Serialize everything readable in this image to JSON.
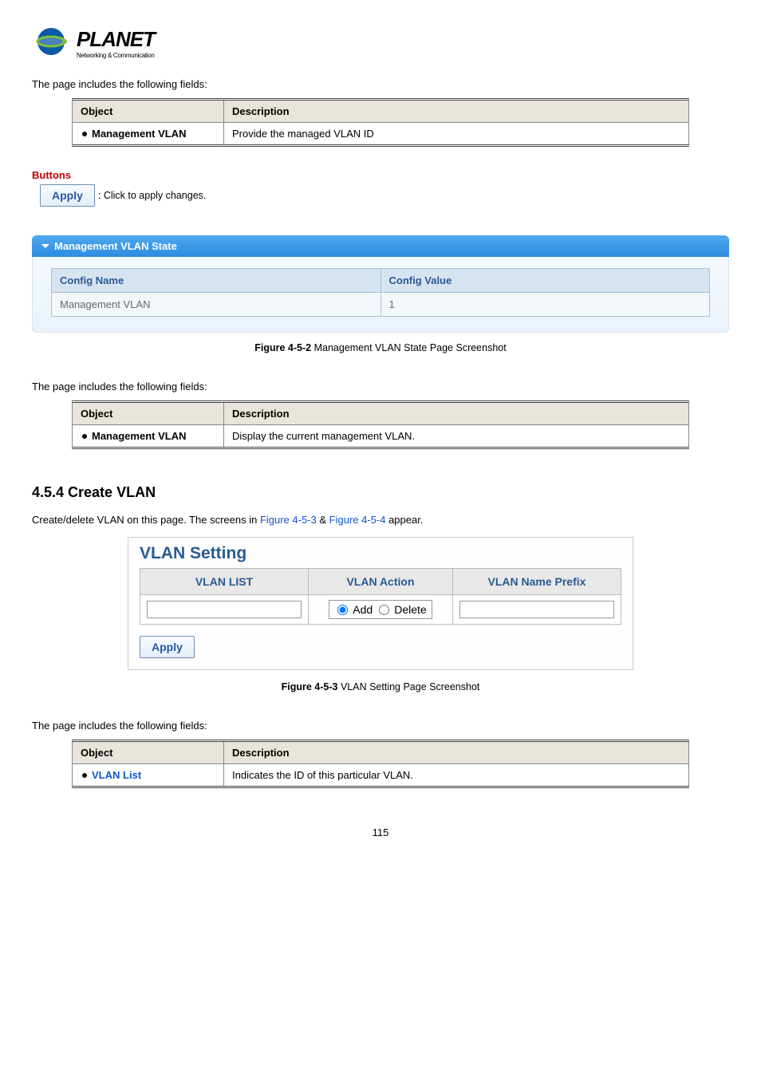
{
  "logo": {
    "brand": "PLANET",
    "tagline": "Networking & Communication"
  },
  "intro1": "The page includes the following fields:",
  "table1": {
    "headers": {
      "object": "Object",
      "description": "Description"
    },
    "row": {
      "object": "Management VLAN",
      "description": "Provide the managed VLAN ID"
    }
  },
  "buttons": {
    "title": "Buttons",
    "apply": "Apply",
    "apply_desc": ": Click to apply changes."
  },
  "panel": {
    "title": "Management VLAN State",
    "headers": {
      "name": "Config Name",
      "value": "Config Value"
    },
    "row": {
      "name": "Management VLAN",
      "value": "1"
    }
  },
  "caption1": {
    "fig": "Figure 4-5-2",
    "text": " Management VLAN State Page Screenshot"
  },
  "intro2": "The page includes the following fields:",
  "table2": {
    "headers": {
      "object": "Object",
      "description": "Description"
    },
    "row": {
      "object": "Management VLAN",
      "description": "Display the current management VLAN."
    }
  },
  "section": {
    "heading": "4.5.4 Create VLAN",
    "lead_pre": "Create/delete VLAN on this page. The screens in ",
    "figa": "Figure 4-5-3",
    "amp": " & ",
    "figb": "Figure 4-5-4",
    "lead_post": " appear."
  },
  "vlan_setting": {
    "title": "VLAN Setting",
    "headers": {
      "list": "VLAN LIST",
      "action": "VLAN Action",
      "prefix": "VLAN Name Prefix"
    },
    "action": {
      "add": "Add",
      "delete": "Delete"
    },
    "apply": "Apply"
  },
  "caption2": {
    "fig": "Figure 4-5-3",
    "text": " VLAN Setting Page Screenshot"
  },
  "intro3": "The page includes the following fields:",
  "table3": {
    "headers": {
      "object": "Object",
      "description": "Description"
    },
    "row": {
      "object": "VLAN List",
      "description": "Indicates the ID of this particular VLAN."
    }
  },
  "pagenum": "115"
}
